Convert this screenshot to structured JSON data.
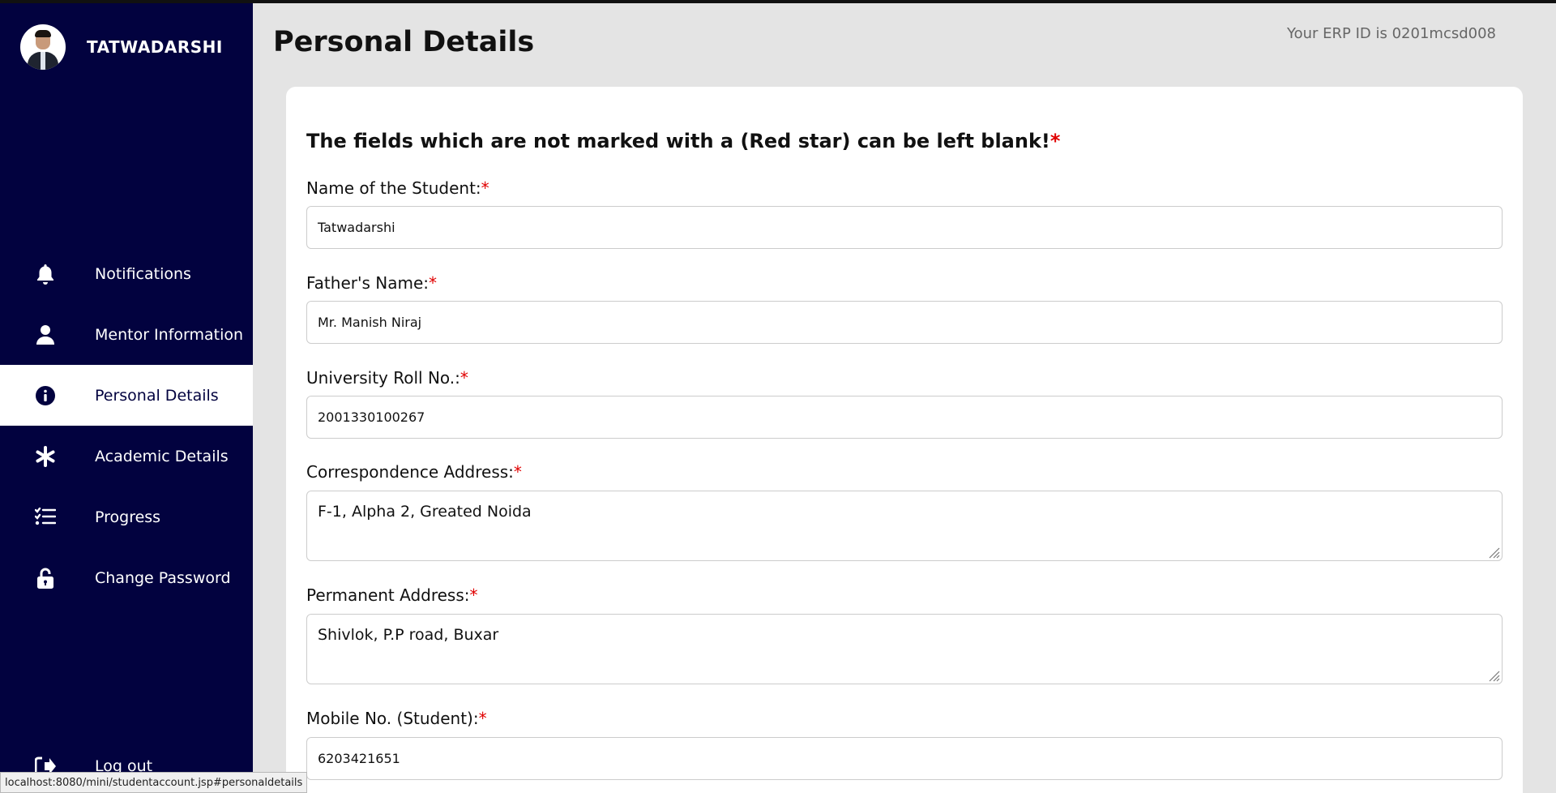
{
  "sidebar": {
    "profile_name": "TATWADARSHI",
    "items": [
      {
        "label": "Notifications",
        "icon": "bell-icon",
        "active": false
      },
      {
        "label": "Mentor Information",
        "icon": "user-icon",
        "active": false
      },
      {
        "label": "Personal Details",
        "icon": "info-circle-icon",
        "active": true
      },
      {
        "label": "Academic Details",
        "icon": "asterisk-icon",
        "active": false
      },
      {
        "label": "Progress",
        "icon": "checklist-icon",
        "active": false
      },
      {
        "label": "Change Password",
        "icon": "unlock-icon",
        "active": false
      }
    ],
    "logout_label": "Log out"
  },
  "header": {
    "title": "Personal Details",
    "erp_id_text": "Your ERP ID is 0201mcsd008"
  },
  "form": {
    "notice": "The fields which are not marked with a (Red star) can be left blank!",
    "required_marker": "*",
    "fields": [
      {
        "label": "Name of the Student:",
        "value": "Tatwadarshi"
      },
      {
        "label": "Father's Name:",
        "value": "Mr. Manish Niraj"
      },
      {
        "label": "University Roll No.:",
        "value": "2001330100267"
      },
      {
        "label": "Correspondence Address:",
        "value": "F-1, Alpha 2, Greated Noida"
      },
      {
        "label": "Permanent Address:",
        "value": "Shivlok, P.P road, Buxar"
      },
      {
        "label": "Mobile No. (Student):",
        "value": "6203421651"
      }
    ]
  },
  "status_bar": {
    "url": "localhost:8080/mini/studentaccount.jsp#personaldetails"
  },
  "colors": {
    "sidebar_bg": "#02023f",
    "page_bg": "#e4e4e4",
    "required_star": "#e00000"
  }
}
